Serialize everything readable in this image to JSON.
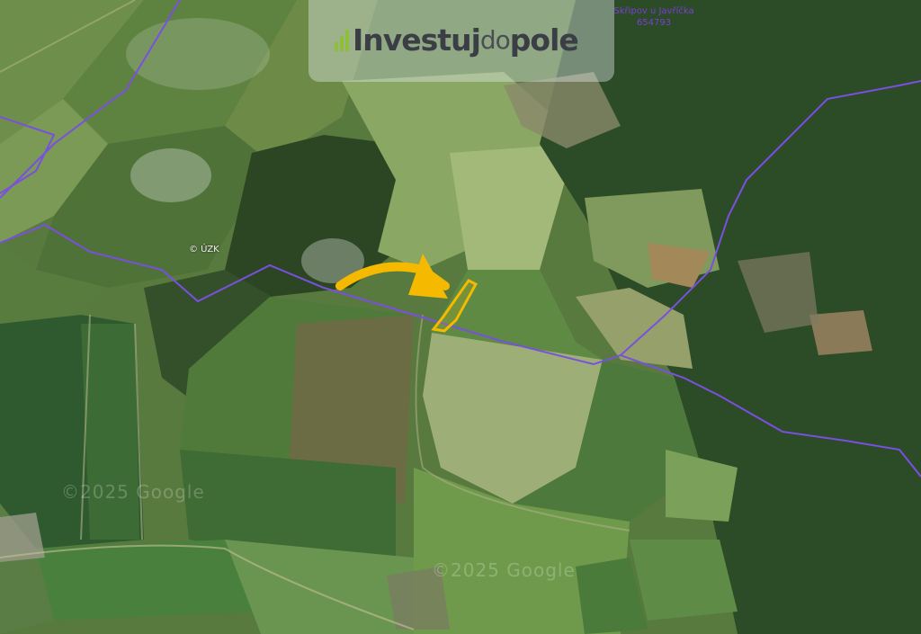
{
  "logo": {
    "part1": "Investuj",
    "part2": "do",
    "part3": "pole",
    "bar_color": "#8fbf3a"
  },
  "admin_area": {
    "name": "Skřipov u Javříčka",
    "code": "654793",
    "boundary_color": "#7b4fe0"
  },
  "map_copyright": "© ÚZK",
  "watermarks": [
    "©2025 Google",
    "©2025 Google"
  ],
  "parcel": {
    "outline_color": "#f5b900",
    "pointer": "arrow pointing to highlighted parcel"
  }
}
